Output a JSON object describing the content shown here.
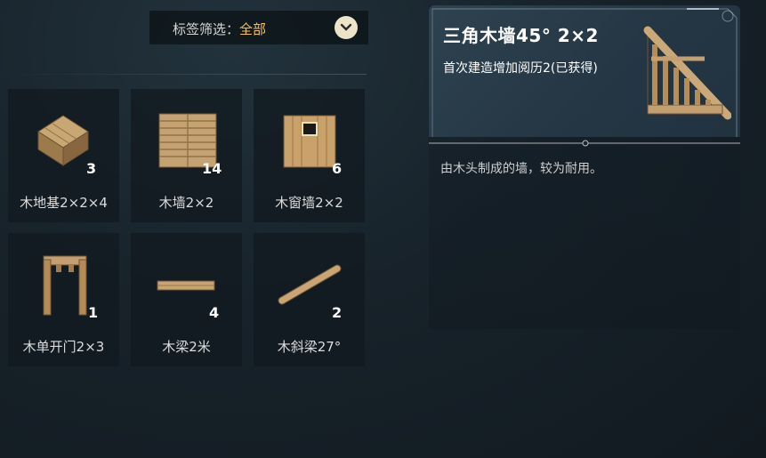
{
  "filter": {
    "label": "标签筛选：",
    "value": "全部"
  },
  "items": [
    {
      "name": "木地基2×2×4",
      "count": "3"
    },
    {
      "name": "木墙2×2",
      "count": "14"
    },
    {
      "name": "木窗墙2×2",
      "count": "6"
    },
    {
      "name": "木单开门2×3",
      "count": "1"
    },
    {
      "name": "木梁2米",
      "count": "4"
    },
    {
      "name": "木斜梁27°",
      "count": "2"
    }
  ],
  "detail": {
    "title": "三角木墙45° 2×2",
    "subtitle": "首次建造增加阅历2(已获得)",
    "description": "由木头制成的墙，较为耐用。"
  },
  "colors": {
    "accent": "#f2c35a",
    "wood": "#b8945e",
    "wood_dark": "#7d5f38"
  }
}
